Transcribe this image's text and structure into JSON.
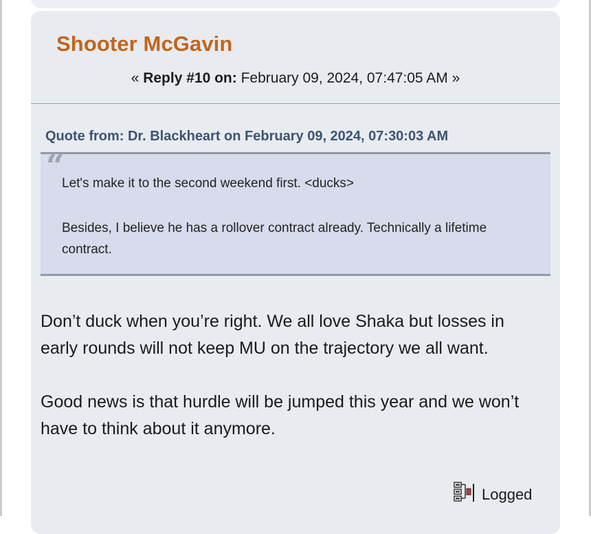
{
  "post": {
    "author": "Shooter McGavin",
    "meta_prefix": "« ",
    "reply_label": "Reply #10 on:",
    "timestamp": "February 09, 2024, 07:47:05 AM",
    "meta_suffix": " »",
    "quote": {
      "header": "Quote from: Dr. Blackheart on February 09, 2024, 07:30:03 AM",
      "mark": "“",
      "paragraphs": [
        "Let's make it to the second weekend first. <ducks>",
        "Besides, I believe he has a rollover contract already. Technically a lifetime contract."
      ]
    },
    "body": [
      "Don’t duck when you’re right.  We all love Shaka but losses in early rounds will not keep MU on the trajectory we all want.",
      "Good news is that hurdle will be jumped this year and we won’t have to think about it anymore."
    ],
    "logged_label": "Logged",
    "logged_icon": "ip-logged-icon"
  },
  "colors": {
    "author": "#c0661d",
    "quote_header": "#3e5370",
    "quote_background": "#d7dbec",
    "card_background": "#e8ebf0"
  }
}
